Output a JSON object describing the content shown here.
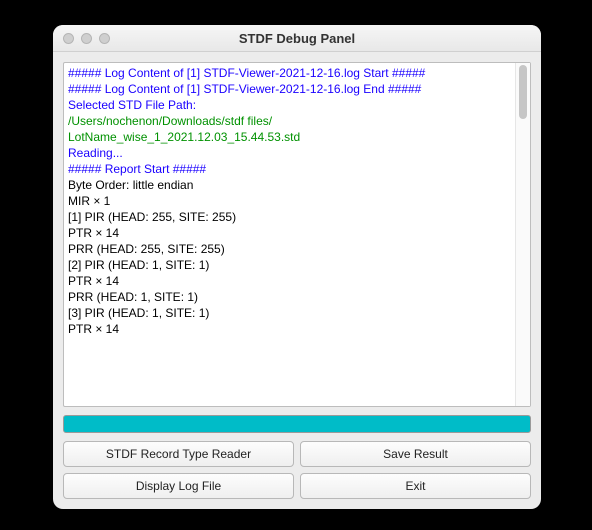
{
  "window": {
    "title": "STDF Debug Panel"
  },
  "log": {
    "lines": [
      {
        "text": "##### Log Content of [1] STDF-Viewer-2021-12-16.log Start #####",
        "color": "blue"
      },
      {
        "text": "##### Log Content of [1] STDF-Viewer-2021-12-16.log End #####",
        "color": "blue"
      },
      {
        "text": "",
        "color": "black"
      },
      {
        "text": "",
        "color": "black"
      },
      {
        "text": "Selected STD File Path:",
        "color": "blue"
      },
      {
        "text": "/Users/nochenon/Downloads/stdf files/",
        "color": "green"
      },
      {
        "text": "LotName_wise_1_2021.12.03_15.44.53.std",
        "color": "green"
      },
      {
        "text": "Reading...",
        "color": "blue"
      },
      {
        "text": "##### Report Start #####",
        "color": "blue"
      },
      {
        "text": "Byte Order: little endian",
        "color": "black"
      },
      {
        "text": "MIR × 1",
        "color": "black"
      },
      {
        "text": "[1] PIR (HEAD: 255, SITE: 255)",
        "color": "black"
      },
      {
        "text": "PTR × 14",
        "color": "black"
      },
      {
        "text": "PRR (HEAD: 255, SITE: 255)",
        "color": "black"
      },
      {
        "text": "[2] PIR (HEAD: 1, SITE: 1)",
        "color": "black"
      },
      {
        "text": "PTR × 14",
        "color": "black"
      },
      {
        "text": "PRR (HEAD: 1, SITE: 1)",
        "color": "black"
      },
      {
        "text": "[3] PIR (HEAD: 1, SITE: 1)",
        "color": "black"
      },
      {
        "text": "PTR × 14",
        "color": "black"
      }
    ]
  },
  "progress": {
    "percent": 100,
    "color": "#00bcc8"
  },
  "buttons": {
    "record_reader": "STDF Record Type Reader",
    "save_result": "Save Result",
    "display_log": "Display Log File",
    "exit": "Exit"
  }
}
